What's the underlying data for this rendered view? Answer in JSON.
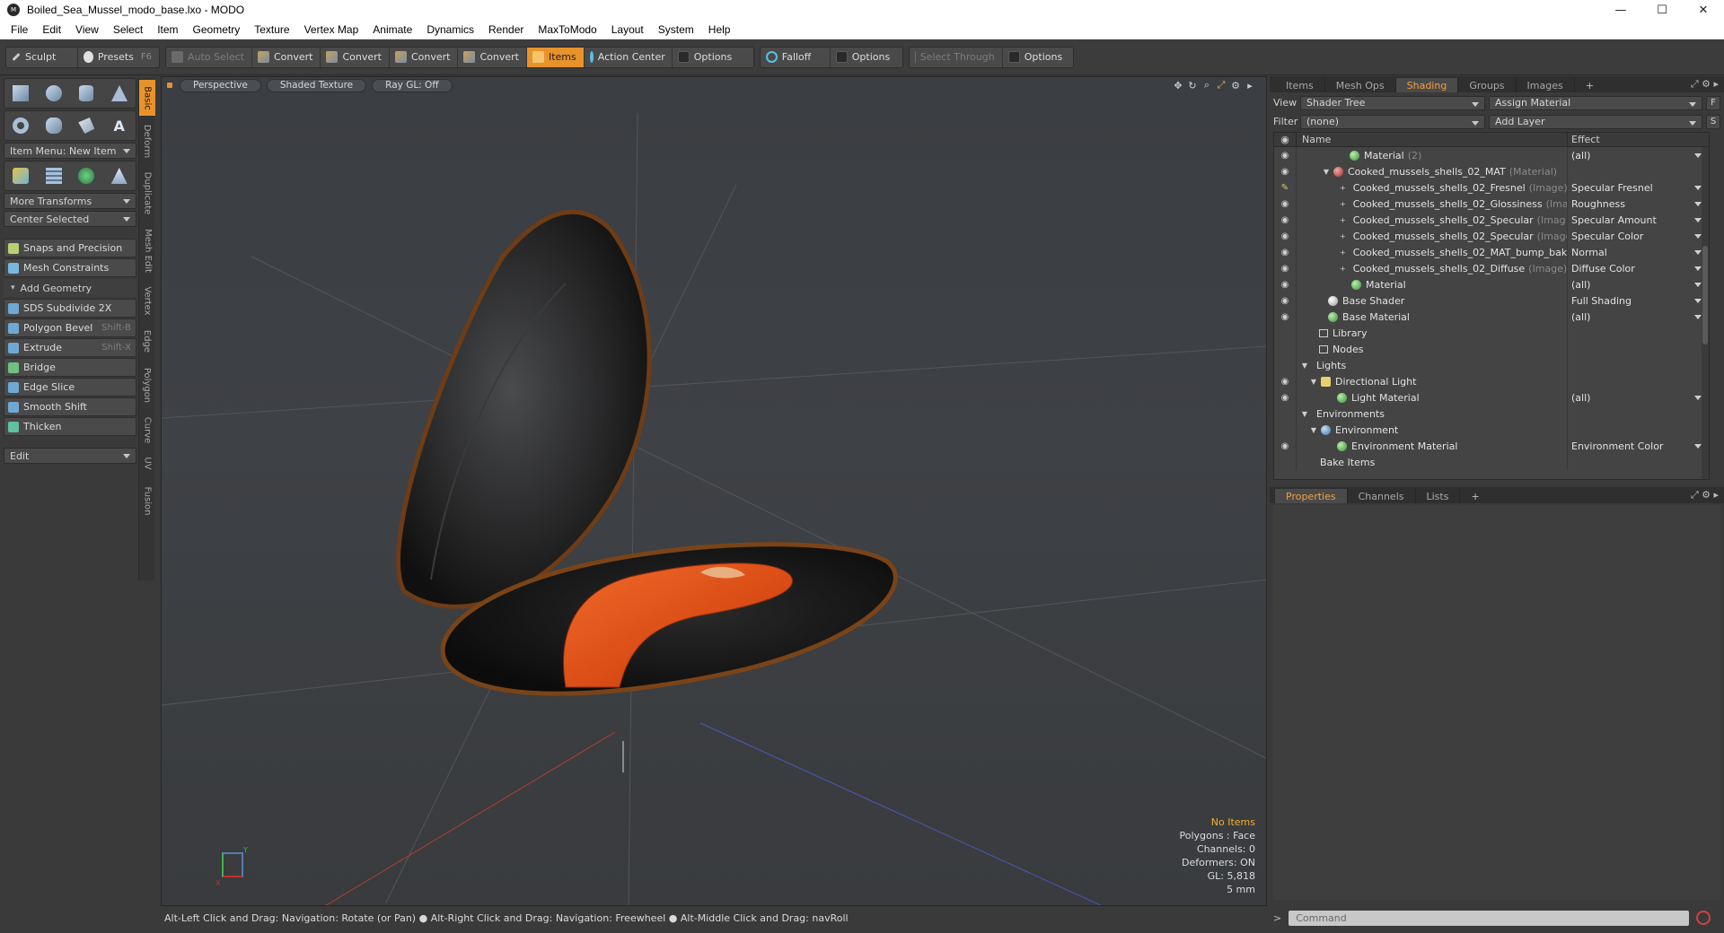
{
  "window": {
    "title": "Boiled_Sea_Mussel_modo_base.lxo - MODO",
    "minimize": "—",
    "maximize": "☐",
    "close": "✕"
  },
  "menu": [
    "File",
    "Edit",
    "View",
    "Select",
    "Item",
    "Geometry",
    "Texture",
    "Vertex Map",
    "Animate",
    "Dynamics",
    "Render",
    "MaxToModo",
    "Layout",
    "System",
    "Help"
  ],
  "toolbar": {
    "sculpt": "Sculpt",
    "presets": "Presets",
    "presets_key": "F6",
    "auto_select": "Auto Select",
    "convert_1": "Convert",
    "convert_2": "Convert",
    "convert_3": "Convert",
    "convert_4": "Convert",
    "items": "Items",
    "action_center": "Action Center",
    "options_1": "Options",
    "falloff": "Falloff",
    "options_2": "Options",
    "select_through": "Select Through",
    "options_3": "Options"
  },
  "left": {
    "item_menu": "Item Menu: New Item",
    "more_transforms": "More Transforms",
    "center_selected": "Center Selected",
    "snaps": "Snaps and Precision",
    "mesh_constraints": "Mesh Constraints",
    "add_geometry": "Add Geometry",
    "tools": [
      {
        "label": "SDS Subdivide 2X",
        "shortcut": ""
      },
      {
        "label": "Polygon Bevel",
        "shortcut": "Shift-B"
      },
      {
        "label": "Extrude",
        "shortcut": "Shift-X"
      },
      {
        "label": "Bridge",
        "shortcut": ""
      },
      {
        "label": "Edge Slice",
        "shortcut": ""
      },
      {
        "label": "Smooth Shift",
        "shortcut": ""
      },
      {
        "label": "Thicken",
        "shortcut": ""
      }
    ],
    "edit_dropdown": "Edit",
    "vtabs": [
      "Basic",
      "Deform",
      "Duplicate",
      "Mesh Edit",
      "Vertex",
      "Edge",
      "Polygon",
      "Curve",
      "UV",
      "Fusion"
    ]
  },
  "viewport": {
    "view": "Perspective",
    "shading": "Shaded Texture",
    "raygl": "Ray GL: Off",
    "stats": {
      "items": "No Items",
      "polygons": "Polygons : Face",
      "channels": "Channels: 0",
      "deformers": "Deformers: ON",
      "gl": "GL: 5,818",
      "scale": "5 mm"
    }
  },
  "status": "Alt-Left Click and Drag: Navigation: Rotate (or Pan) ● Alt-Right Click and Drag: Navigation: Freewheel ● Alt-Middle Click and Drag: navRoll",
  "right": {
    "tabs": [
      "Items",
      "Mesh Ops",
      "Shading",
      "Groups",
      "Images"
    ],
    "view_label": "View",
    "view_value": "Shader Tree",
    "assign_material": "Assign Material",
    "f_btn": "F",
    "filter_label": "Filter",
    "filter_value": "(none)",
    "add_layer": "Add Layer",
    "s_btn": "S",
    "col_name": "Name",
    "col_effect": "Effect",
    "rows": [
      {
        "name": "Material",
        "suffix": "(2)",
        "effect": "(all)"
      },
      {
        "name": "Cooked_mussels_shells_02_MAT",
        "suffix": "(Material)",
        "effect": ""
      },
      {
        "name": "Cooked_mussels_shells_02_Fresnel",
        "suffix": "(Image)",
        "effect": "Specular Fresnel"
      },
      {
        "name": "Cooked_mussels_shells_02_Glossiness",
        "suffix": "(Ima ...",
        "effect": "Roughness"
      },
      {
        "name": "Cooked_mussels_shells_02_Specular",
        "suffix": "(Imag ...",
        "effect": "Specular Amount"
      },
      {
        "name": "Cooked_mussels_shells_02_Specular",
        "suffix": "(Image)",
        "effect": "Specular Color"
      },
      {
        "name": "Cooked_mussels_shells_02_MAT_bump_bak ...",
        "suffix": "",
        "effect": "Normal"
      },
      {
        "name": "Cooked_mussels_shells_02_Diffuse",
        "suffix": "(Image)",
        "effect": "Diffuse Color"
      },
      {
        "name": "Material",
        "suffix": "",
        "effect": "(all)"
      },
      {
        "name": "Base Shader",
        "suffix": "",
        "effect": "Full Shading"
      },
      {
        "name": "Base Material",
        "suffix": "",
        "effect": "(all)"
      },
      {
        "name": "Library",
        "suffix": "",
        "effect": ""
      },
      {
        "name": "Nodes",
        "suffix": "",
        "effect": ""
      },
      {
        "name": "Lights",
        "suffix": "",
        "effect": ""
      },
      {
        "name": "Directional Light",
        "suffix": "",
        "effect": ""
      },
      {
        "name": "Light Material",
        "suffix": "",
        "effect": "(all)"
      },
      {
        "name": "Environments",
        "suffix": "",
        "effect": ""
      },
      {
        "name": "Environment",
        "suffix": "",
        "effect": ""
      },
      {
        "name": "Environment Material",
        "suffix": "",
        "effect": "Environment Color"
      },
      {
        "name": "Bake Items",
        "suffix": "",
        "effect": ""
      }
    ],
    "prop_tabs": [
      "Properties",
      "Channels",
      "Lists"
    ],
    "command_placeholder": "Command"
  },
  "colors": {
    "accent": "#e8932a",
    "shell": "#1e1e1e",
    "shell_rim": "#7a4418",
    "meat": "#e8501c"
  }
}
